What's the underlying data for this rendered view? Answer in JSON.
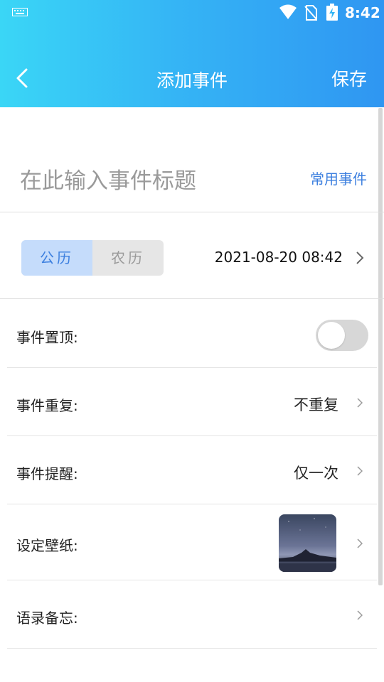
{
  "status_bar": {
    "time": "8:42"
  },
  "nav": {
    "title": "添加事件",
    "save_label": "保存"
  },
  "title_input": {
    "placeholder": "在此输入事件标题",
    "common_events_label": "常用事件"
  },
  "calendar": {
    "solar_label": "公历",
    "lunar_label": "农历",
    "selected": "solar",
    "datetime": "2021-08-20  08:42"
  },
  "settings": {
    "pin": {
      "label": "事件置顶:",
      "enabled": false
    },
    "repeat": {
      "label": "事件重复:",
      "value": "不重复"
    },
    "reminder": {
      "label": "事件提醒:",
      "value": "仅一次"
    },
    "wallpaper": {
      "label": "设定壁纸:"
    },
    "quote": {
      "label": "语录备忘:"
    }
  },
  "colors": {
    "header_start": "#3ad6f6",
    "header_end": "#2f96f2",
    "accent": "#3c7fdf"
  }
}
